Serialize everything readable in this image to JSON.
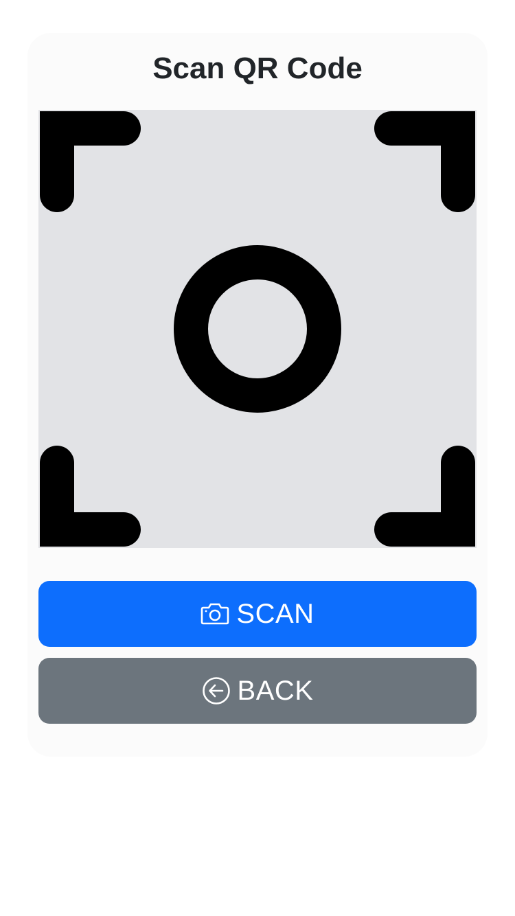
{
  "header": {
    "title": "Scan QR Code"
  },
  "viewfinder": {
    "background_color": "#e2e3e6",
    "mark_color": "#000000",
    "icon": "scan-frame-icon"
  },
  "actions": {
    "scan": {
      "label": "SCAN",
      "icon": "camera-icon",
      "color": "#0d6efd"
    },
    "back": {
      "label": "BACK",
      "icon": "arrow-left-circle-icon",
      "color": "#6c757d"
    }
  }
}
